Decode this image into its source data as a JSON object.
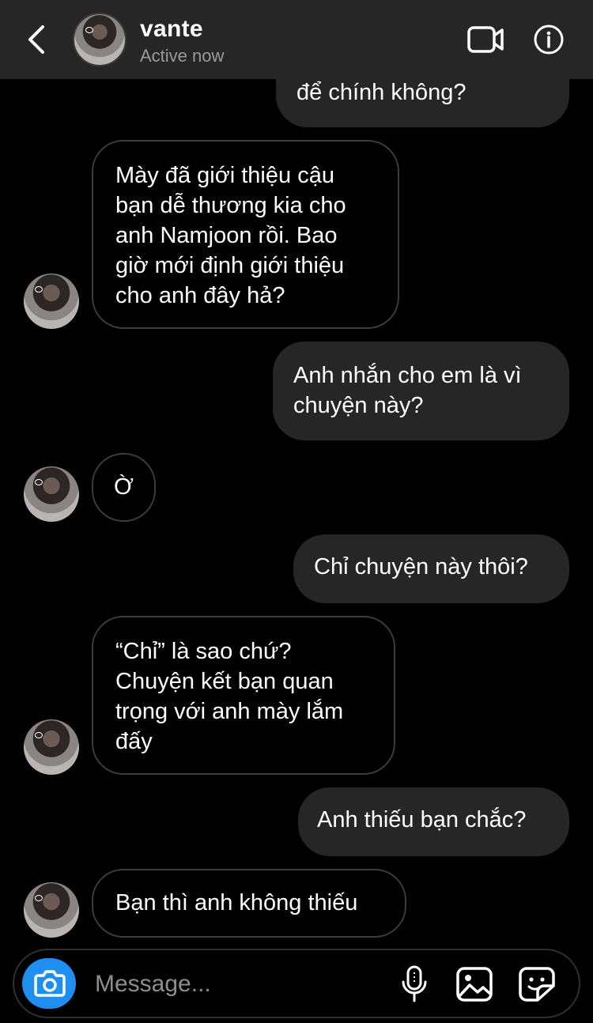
{
  "header": {
    "name": "vante",
    "status": "Active now"
  },
  "icons": {
    "back": "chevron-left-icon",
    "video": "video-camera-icon",
    "info": "info-icon",
    "camera": "camera-icon",
    "mic": "microphone-icon",
    "gallery": "image-icon",
    "sticker": "sticker-icon"
  },
  "colors": {
    "header_bg": "#262626",
    "outgoing_bubble": "#262626",
    "incoming_border": "#3c3c3c",
    "camera_accent": "#1f8ef1",
    "status_text": "#9a9a9a"
  },
  "messages": [
    {
      "from": "me",
      "text": "để chính không?"
    },
    {
      "from": "them",
      "text": "Mày đã giới thiệu cậu bạn dễ thương kia cho anh Namjoon rồi. Bao giờ mới định giới thiệu cho anh đây hả?"
    },
    {
      "from": "me",
      "text": "Anh nhắn cho em là vì chuyện này?"
    },
    {
      "from": "them",
      "text": "Ờ"
    },
    {
      "from": "me",
      "text": "Chỉ chuyện này thôi?"
    },
    {
      "from": "them",
      "text": "“Chỉ” là sao chứ? Chuyện kết bạn quan trọng với anh mày lắm đấy"
    },
    {
      "from": "me",
      "text": "Anh thiếu bạn chắc?"
    },
    {
      "from": "them",
      "text": "Bạn thì anh không thiếu"
    }
  ],
  "composer": {
    "placeholder": "Message..."
  }
}
